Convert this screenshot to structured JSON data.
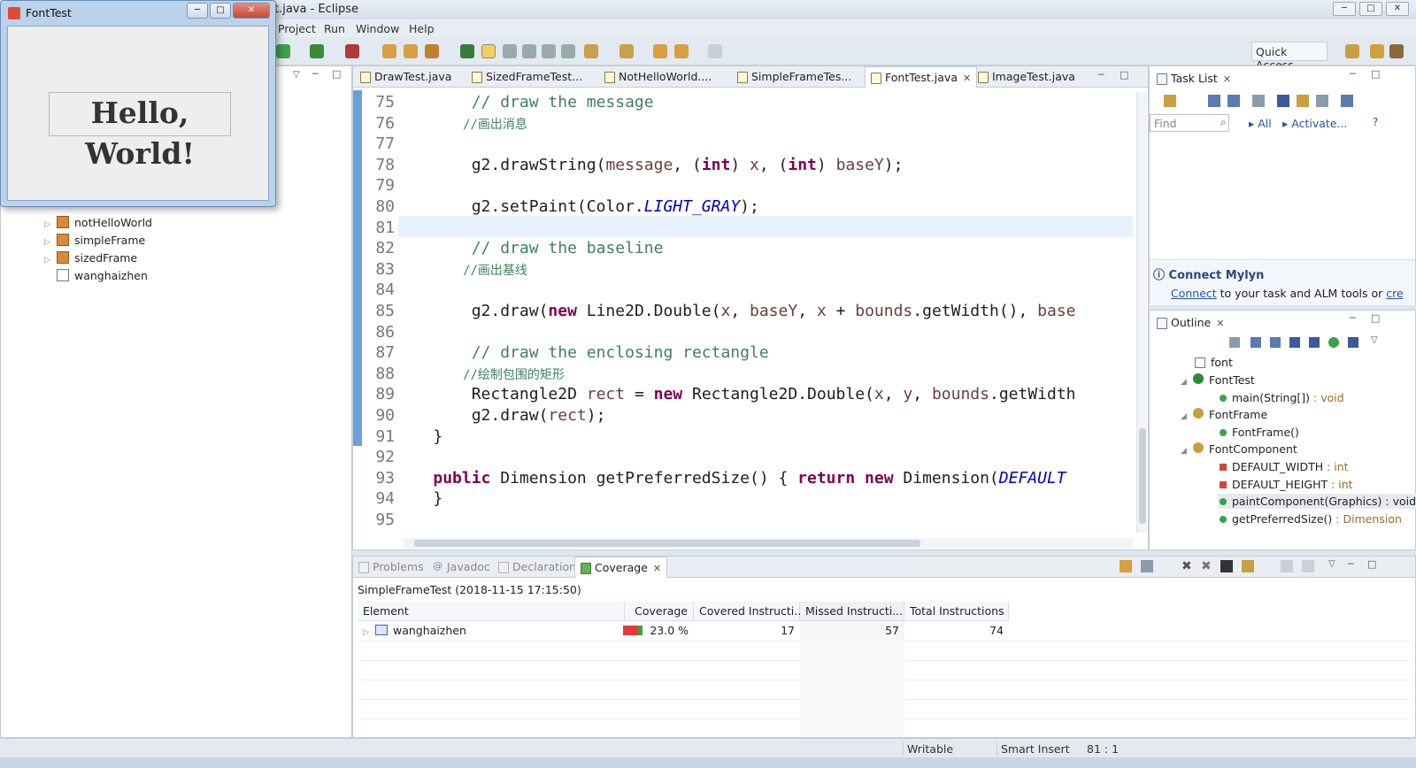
{
  "window": {
    "title": "t.java - Eclipse"
  },
  "menu": [
    "Project",
    "Run",
    "Window",
    "Help"
  ],
  "quick_access": "Quick Access",
  "package_explorer": {
    "items": [
      {
        "label": "notHelloWorld",
        "expandable": true
      },
      {
        "label": "simpleFrame",
        "expandable": true
      },
      {
        "label": "sizedFrame",
        "expandable": true
      },
      {
        "label": "wanghaizhen",
        "expandable": false
      }
    ]
  },
  "editor": {
    "tabs": [
      {
        "label": "DrawTest.java",
        "active": false
      },
      {
        "label": "SizedFrameTest...",
        "active": false
      },
      {
        "label": "NotHelloWorld....",
        "active": false
      },
      {
        "label": "SimpleFrameTes...",
        "active": false
      },
      {
        "label": "FontTest.java",
        "active": true
      },
      {
        "label": "ImageTest.java",
        "active": false
      }
    ],
    "lines": [
      {
        "n": "75",
        "parts": [
          [
            "cmt",
            "    // draw the message"
          ]
        ]
      },
      {
        "n": "76",
        "parts": [
          [
            "cmt-cn",
            "    //画出消息"
          ]
        ]
      },
      {
        "n": "77",
        "parts": [
          [
            "code-txt",
            ""
          ]
        ]
      },
      {
        "n": "78",
        "parts": [
          [
            "code-txt",
            "    g2.drawString("
          ],
          [
            "var",
            "message"
          ],
          [
            "code-txt",
            ", ("
          ],
          [
            "kw",
            "int"
          ],
          [
            "code-txt",
            ") "
          ],
          [
            "var",
            "x"
          ],
          [
            "code-txt",
            ", ("
          ],
          [
            "kw",
            "int"
          ],
          [
            "code-txt",
            ") "
          ],
          [
            "var",
            "baseY"
          ],
          [
            "code-txt",
            ");"
          ]
        ]
      },
      {
        "n": "79",
        "parts": [
          [
            "code-txt",
            ""
          ]
        ]
      },
      {
        "n": "80",
        "parts": [
          [
            "code-txt",
            "    g2.setPaint(Color."
          ],
          [
            "cst",
            "LIGHT_GRAY"
          ],
          [
            "code-txt",
            ");"
          ]
        ]
      },
      {
        "n": "81",
        "parts": [
          [
            "code-txt",
            ""
          ]
        ]
      },
      {
        "n": "82",
        "parts": [
          [
            "cmt",
            "    // draw the baseline"
          ]
        ]
      },
      {
        "n": "83",
        "parts": [
          [
            "cmt-cn",
            "    //画出基线"
          ]
        ]
      },
      {
        "n": "84",
        "parts": [
          [
            "code-txt",
            ""
          ]
        ]
      },
      {
        "n": "85",
        "parts": [
          [
            "code-txt",
            "    g2.draw("
          ],
          [
            "kw",
            "new"
          ],
          [
            "code-txt",
            " Line2D.Double("
          ],
          [
            "var",
            "x"
          ],
          [
            "code-txt",
            ", "
          ],
          [
            "var",
            "baseY"
          ],
          [
            "code-txt",
            ", "
          ],
          [
            "var",
            "x"
          ],
          [
            "code-txt",
            " + "
          ],
          [
            "var",
            "bounds"
          ],
          [
            "code-txt",
            ".getWidth(), "
          ],
          [
            "var",
            "base"
          ]
        ]
      },
      {
        "n": "86",
        "parts": [
          [
            "code-txt",
            ""
          ]
        ]
      },
      {
        "n": "87",
        "parts": [
          [
            "cmt",
            "    // draw the enclosing rectangle"
          ]
        ]
      },
      {
        "n": "88",
        "parts": [
          [
            "cmt-cn",
            "    //绘制包围的矩形"
          ]
        ]
      },
      {
        "n": "89",
        "parts": [
          [
            "code-txt",
            "    Rectangle2D "
          ],
          [
            "var",
            "rect"
          ],
          [
            "code-txt",
            " = "
          ],
          [
            "kw",
            "new"
          ],
          [
            "code-txt",
            " Rectangle2D.Double("
          ],
          [
            "var",
            "x"
          ],
          [
            "code-txt",
            ", "
          ],
          [
            "var",
            "y"
          ],
          [
            "code-txt",
            ", "
          ],
          [
            "var",
            "bounds"
          ],
          [
            "code-txt",
            ".getWidth"
          ]
        ]
      },
      {
        "n": "90",
        "parts": [
          [
            "code-txt",
            "    g2.draw("
          ],
          [
            "var",
            "rect"
          ],
          [
            "code-txt",
            ");"
          ]
        ]
      },
      {
        "n": "91",
        "parts": [
          [
            "code-txt",
            "}"
          ]
        ]
      },
      {
        "n": "92",
        "parts": [
          [
            "code-txt",
            ""
          ]
        ]
      },
      {
        "n": "93",
        "parts": [
          [
            "kw",
            "public"
          ],
          [
            "code-txt",
            " Dimension getPreferredSize() { "
          ],
          [
            "kw",
            "return"
          ],
          [
            "code-txt",
            " "
          ],
          [
            "kw",
            "new"
          ],
          [
            "code-txt",
            " Dimension("
          ],
          [
            "cst",
            "DEFAULT"
          ]
        ]
      },
      {
        "n": "94",
        "parts": [
          [
            "code-txt",
            "}"
          ]
        ]
      },
      {
        "n": "95",
        "parts": [
          [
            "code-txt",
            ""
          ]
        ]
      }
    ]
  },
  "fonttest_window": {
    "title": "FontTest",
    "message": "Hello, World!"
  },
  "task_list": {
    "tab": "Task List",
    "find_placeholder": "Find",
    "all": "All",
    "activate": "Activate...",
    "mylyn_title": "Connect Mylyn",
    "mylyn_link": "Connect",
    "mylyn_text": " to your task and ALM tools or ",
    "mylyn_link2": "cre"
  },
  "outline": {
    "tab": "Outline",
    "items": [
      {
        "label": "font",
        "ret": ""
      },
      {
        "label": "FontTest",
        "ret": ""
      },
      {
        "label": "main(String[])",
        "ret": " : void"
      },
      {
        "label": "FontFrame",
        "ret": ""
      },
      {
        "label": "FontFrame()",
        "ret": ""
      },
      {
        "label": "FontComponent",
        "ret": ""
      },
      {
        "label": "DEFAULT_WIDTH",
        "ret": " : int"
      },
      {
        "label": "DEFAULT_HEIGHT",
        "ret": " : int"
      },
      {
        "label": "paintComponent(Graphics)",
        "ret": " : void"
      },
      {
        "label": "getPreferredSize()",
        "ret": " : Dimension"
      }
    ]
  },
  "bottom": {
    "tabs": [
      "Problems",
      "Javadoc",
      "Declaration",
      "Coverage"
    ],
    "session": "SimpleFrameTest (2018-11-15 17:15:50)",
    "columns": [
      "Element",
      "Coverage",
      "Covered Instructi...",
      "Missed Instructi...",
      "Total Instructions"
    ],
    "rows": [
      {
        "element": "wanghaizhen",
        "coverage": "23.0 %",
        "covered": "17",
        "missed": "57",
        "total": "74"
      }
    ]
  },
  "status": {
    "writable": "Writable",
    "insert": "Smart Insert",
    "position": "81 : 1"
  }
}
